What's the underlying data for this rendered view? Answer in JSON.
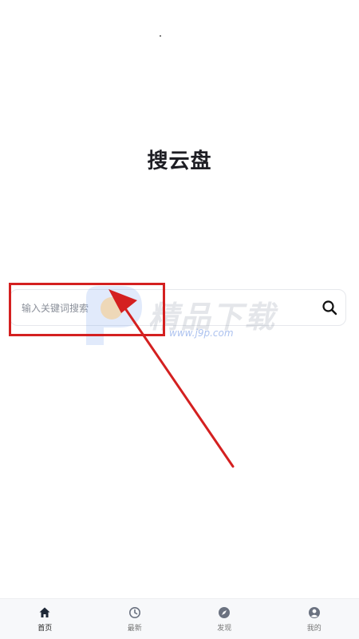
{
  "app": {
    "title": "搜云盘"
  },
  "search": {
    "placeholder": "输入关键词搜索",
    "value": ""
  },
  "watermark": {
    "text": "精品下载",
    "url": "www.j9p.com"
  },
  "annotation": {
    "color": "#d42020"
  },
  "tabbar": {
    "active_color": "#1f2937",
    "inactive_color": "#6b7280",
    "items": [
      {
        "label": "首页",
        "icon": "home-icon",
        "active": true
      },
      {
        "label": "最新",
        "icon": "clock-icon",
        "active": false
      },
      {
        "label": "发现",
        "icon": "compass-icon",
        "active": false
      },
      {
        "label": "我的",
        "icon": "user-circle-icon",
        "active": false
      }
    ]
  }
}
